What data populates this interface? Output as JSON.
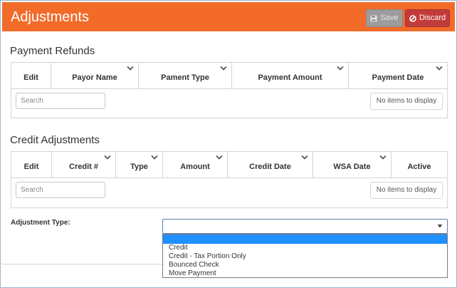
{
  "header": {
    "title": "Adjustments",
    "save_label": "Save",
    "discard_label": "Discard",
    "background": "#f26b29"
  },
  "payment_refunds": {
    "title": "Payment Refunds",
    "columns": [
      "Edit",
      "Payor Name",
      "Pament Type",
      "Payment Amount",
      "Payment Date"
    ],
    "search_placeholder": "Search",
    "empty_text": "No items to display"
  },
  "credit_adjustments": {
    "title": "Credit Adjustments",
    "columns": [
      "Edit",
      "Credit #",
      "Type",
      "Amount",
      "Credit Date",
      "WSA Date",
      "Active"
    ],
    "search_placeholder": "Search",
    "empty_text": "No items to display"
  },
  "adjustment_type": {
    "label": "Adjustment Type:",
    "selected_value": "",
    "options": [
      "Credit",
      "Credit - Tax Portion Only",
      "Bounced Check",
      "Move Payment"
    ]
  },
  "icons": {
    "save": "floppy-disk-icon",
    "discard": "ban-icon",
    "column_menu": "chevron-down-icon",
    "select": "triangle-down-icon"
  }
}
